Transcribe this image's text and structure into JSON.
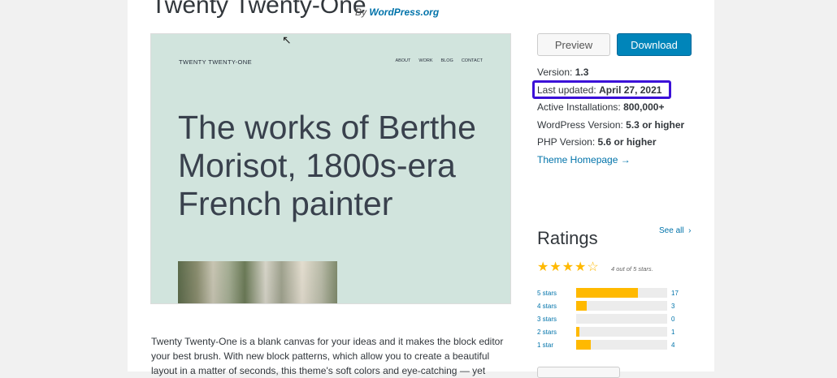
{
  "header": {
    "title": "Twenty Twenty-One",
    "by_prefix": "By",
    "author": "WordPress.org"
  },
  "screenshot": {
    "site_title": "TWENTY TWENTY-ONE",
    "nav": [
      "ABOUT",
      "WORK",
      "BLOG",
      "CONTACT"
    ],
    "headline": "The works of Berthe Morisot, 1800s-era French painter"
  },
  "actions": {
    "preview": "Preview",
    "download": "Download"
  },
  "meta": {
    "version_label": "Version:",
    "version": "1.3",
    "updated_label": "Last updated:",
    "updated": "April 27, 2021",
    "installs_label": "Active Installations:",
    "installs": "800,000+",
    "wp_label": "WordPress Version:",
    "wp": "5.3 or higher",
    "php_label": "PHP Version:",
    "php": "5.6 or higher",
    "homepage": "Theme Homepage →"
  },
  "highlight_color": "#3b10d8",
  "ratings": {
    "heading": "Ratings",
    "see_all": "See all",
    "stars_note": "4 out of 5 stars.",
    "stars": 4,
    "star_color": "#ffb900",
    "rows": [
      {
        "label": "5 stars",
        "count": "17",
        "fraction": 0.68
      },
      {
        "label": "4 stars",
        "count": "3",
        "fraction": 0.12
      },
      {
        "label": "3 stars",
        "count": "0",
        "fraction": 0.0
      },
      {
        "label": "2 stars",
        "count": "1",
        "fraction": 0.04
      },
      {
        "label": "1 star",
        "count": "4",
        "fraction": 0.16
      }
    ]
  },
  "description": "Twenty Twenty-One is a blank canvas for your ideas and it makes the block editor your best brush. With new block patterns, which allow you to create a beautiful layout in a matter of seconds, this theme's soft colors and eye-catching — yet"
}
